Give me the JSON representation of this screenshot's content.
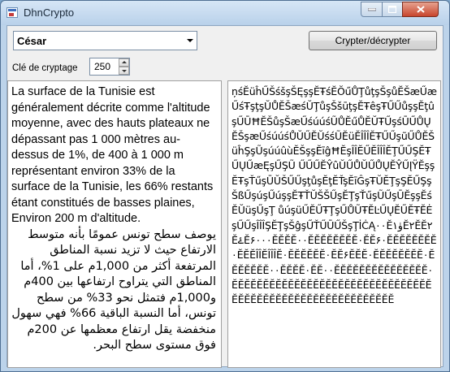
{
  "window": {
    "title": "DhnCrypto"
  },
  "toolbar": {
    "algorithm_selected": "César",
    "crypt_button_label": "Crypter/décrypter"
  },
  "key": {
    "label": "Clé de cryptage",
    "value": "250"
  },
  "input_text": {
    "french": "La surface de la Tunisie est généralement décrite comme l'altitude moyenne, avec des hauts plateaux ne dépassant pas 1 000 mètres au-dessus de 1%, de 400 à 1 000 m représentant environ 33% de la surface de la Tunisie, les 66% restants étant constitués de basses plaines, Environ 200 m d'altitude.",
    "arabic": "يوصف سطح تونس عمومًا بأنه متوسط الارتفاع حيث لا تزيد نسبة المناطق المرتفعة أكثر من 1,000م على 1%، أما المناطق التي يتراوح ارتفاعها بين 400م و1,000م فتمثل نحو 33% من سطح تونس، أما النسبة الباقية 66% فهي سهول منخفضة يقل ارتفاع معظمها عن 200م فوق مستوى سطح البحر."
  },
  "output_text": {
    "cipher": "ņśĔüĥŰŠśšşŠĘşşĔŦśĔŎűŮŢůţşŠşůĔŠæŰæŰśŦşţşŬŮĔŠæśŬŢůşŠšūţşĔŦêşŦŰŰůşşĔţûşŰŪĦĔŠůşŠæŰśúúśŨŮĔűŮĔŬŦŰşśŪŰŮŲĔŠşæŰśúúśŮŬŰĔŬśśŨĔüĔÎÎÎĔŦŰŰşũŰŮĔŠüĥŞşŨşúúûùĔŠşşĔīĝĦĔşÎÎĔŰĔÎÎÎĔŢŰŰŞĔŦŰŲŰæĘşŰŞŨ ŰŰŰĔŶûŬŰŮŬŰŮŲĔŶŰĮŸĔşşĔŦşŤűşŪŬŠŰŰşţůşĔţĔŤşĔīĜşŦŬĔŢşŞĔŰŞşŠßŰşúşŰúşşĔŦŤŬŠŠŰşĔŢşŤűşŨŰşŪĔşşĔśĔŬüşŰşŢ ůúşüŰĔŰŦŢşŰŮŨŦĔĿŰŲĔŰĔŦĔĖşŰŰşÎÎÎŞĔŢşŠĝşŰŤŰŪŰŠşŢİĊĄ۰۰Ĕ۱ۈĔ۲ĔĔ۲ĔۓĔ۶۰۰۰ĔĔĔĔ۰۰ĔĔĔĔĔĔĔĔ۰ĔĔ۶۰ĔĔĔĔĔĔĔĔ۰ĔĔĔÎÎĔÎÎÎĔ۰ĔĔĔĔĔĔ۰ĔĔ۶ĔĔĔ۰ĔĔĔĔĔĔĔĔ۰ĔĔĔĔĔĔĔ۰۰ĔĔĔĔ۰ĔĔ۰۰ĔĔĔĔĔĔĔĔĔĔĔĔĔĔĔ۰ĔĔĔĔĔĔĔĔĔĔĔĔĔĔĔĔĔĔĔĔĔĔĔĔĔĔĔĔĔĔĔĔĔĔĔĔĔĔĔĔĔĔĔĔĔĔĔĔĔĔĔĔĔĔĔĔĔĔ"
  }
}
